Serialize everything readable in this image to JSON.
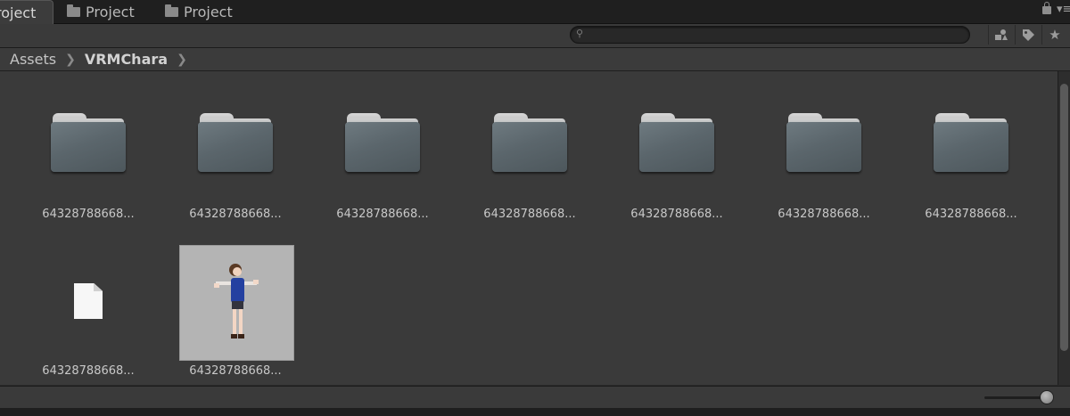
{
  "tabs": [
    {
      "label": "roject",
      "active": true,
      "icon": "folder-icon"
    },
    {
      "label": "Project",
      "active": false,
      "icon": "folder-icon"
    },
    {
      "label": "Project",
      "active": false,
      "icon": "folder-icon"
    }
  ],
  "toolbar": {
    "search_value": "",
    "buttons": [
      "create-by-type-icon",
      "label-tag-icon",
      "favorite-star-icon"
    ]
  },
  "breadcrumb": {
    "items": [
      "Assets",
      "VRMChara"
    ]
  },
  "grid": {
    "items": [
      {
        "type": "folder",
        "label": "64328788668..."
      },
      {
        "type": "folder",
        "label": "64328788668..."
      },
      {
        "type": "folder",
        "label": "64328788668..."
      },
      {
        "type": "folder",
        "label": "64328788668..."
      },
      {
        "type": "folder",
        "label": "64328788668..."
      },
      {
        "type": "folder",
        "label": "64328788668..."
      },
      {
        "type": "folder",
        "label": "64328788668..."
      },
      {
        "type": "file",
        "label": "64328788668..."
      },
      {
        "type": "model-thumbnail",
        "label": "64328788668..."
      }
    ]
  },
  "colors": {
    "background": "#2a2a2a",
    "panel": "#3a3a3a",
    "folder": "#5b666c",
    "thumbnail_bg": "#b4b4b4",
    "character_top": "#2440a0"
  }
}
